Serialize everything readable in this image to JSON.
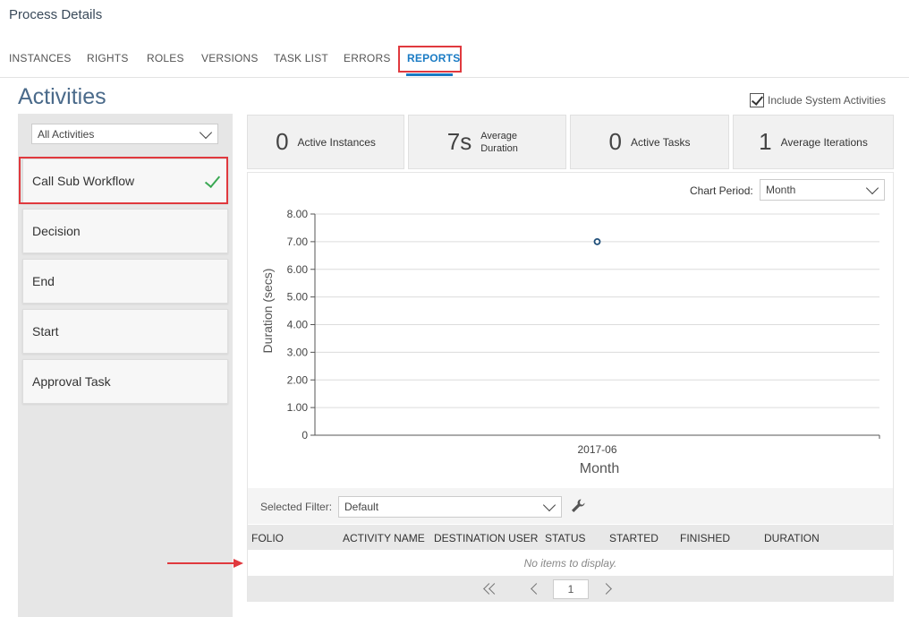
{
  "page": {
    "title": "Process Details"
  },
  "tabs": [
    {
      "label": "INSTANCES"
    },
    {
      "label": "RIGHTS"
    },
    {
      "label": "ROLES"
    },
    {
      "label": "VERSIONS"
    },
    {
      "label": "TASK LIST"
    },
    {
      "label": "ERRORS"
    },
    {
      "label": "REPORTS",
      "active": true
    }
  ],
  "activities": {
    "heading": "Activities",
    "filter_value": "All Activities",
    "items": [
      {
        "label": "Call Sub Workflow",
        "selected": true
      },
      {
        "label": "Decision"
      },
      {
        "label": "End"
      },
      {
        "label": "Start"
      },
      {
        "label": "Approval Task"
      }
    ]
  },
  "include_system": {
    "label": "Include System Activities",
    "checked": true
  },
  "stats": [
    {
      "value": "0",
      "label": "Active Instances"
    },
    {
      "value": "7s",
      "label": "Average Duration"
    },
    {
      "value": "0",
      "label": "Active Tasks"
    },
    {
      "value": "1",
      "label": "Average Iterations"
    }
  ],
  "chart_period": {
    "label": "Chart Period:",
    "value": "Month"
  },
  "chart_data": {
    "type": "line",
    "x": [
      "2017-06"
    ],
    "series": [
      {
        "values": [
          7.0
        ]
      }
    ],
    "xlabel": "Month",
    "ylabel": "Duration (secs)",
    "ylim": [
      0,
      8
    ],
    "yticks": [
      "0",
      "1.00",
      "2.00",
      "3.00",
      "4.00",
      "5.00",
      "6.00",
      "7.00",
      "8.00"
    ],
    "grid": true,
    "colors": {
      "marker": "#1f4e79"
    }
  },
  "filter": {
    "label": "Selected Filter:",
    "value": "Default"
  },
  "grid": {
    "columns": [
      "FOLIO",
      "ACTIVITY NAME",
      "DESTINATION USER",
      "STATUS",
      "STARTED",
      "FINISHED",
      "DURATION"
    ],
    "empty_text": "No items to display."
  },
  "pager": {
    "page": "1"
  },
  "colors": {
    "accent": "#1a7bc4",
    "highlight": "#e0393e",
    "check": "#3aa853"
  }
}
